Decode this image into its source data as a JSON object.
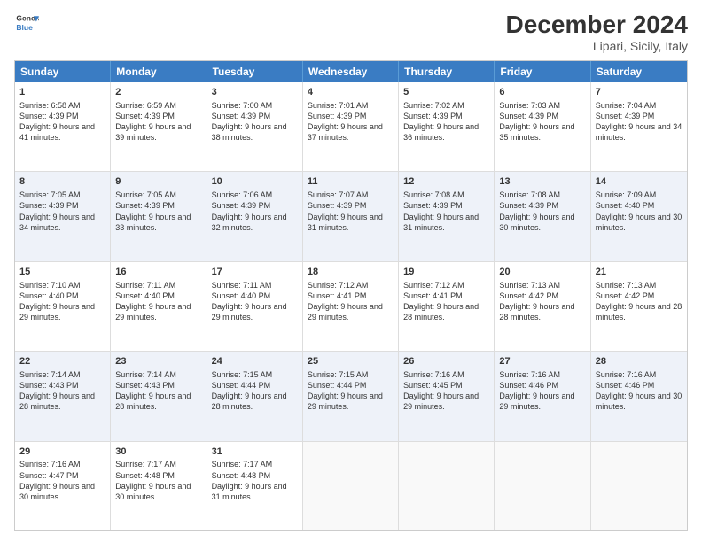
{
  "header": {
    "logo_line1": "General",
    "logo_line2": "Blue",
    "title": "December 2024",
    "subtitle": "Lipari, Sicily, Italy"
  },
  "calendar": {
    "days_of_week": [
      "Sunday",
      "Monday",
      "Tuesday",
      "Wednesday",
      "Thursday",
      "Friday",
      "Saturday"
    ],
    "rows": [
      [
        {
          "day": "1",
          "sunrise": "Sunrise: 6:58 AM",
          "sunset": "Sunset: 4:39 PM",
          "daylight": "Daylight: 9 hours and 41 minutes."
        },
        {
          "day": "2",
          "sunrise": "Sunrise: 6:59 AM",
          "sunset": "Sunset: 4:39 PM",
          "daylight": "Daylight: 9 hours and 39 minutes."
        },
        {
          "day": "3",
          "sunrise": "Sunrise: 7:00 AM",
          "sunset": "Sunset: 4:39 PM",
          "daylight": "Daylight: 9 hours and 38 minutes."
        },
        {
          "day": "4",
          "sunrise": "Sunrise: 7:01 AM",
          "sunset": "Sunset: 4:39 PM",
          "daylight": "Daylight: 9 hours and 37 minutes."
        },
        {
          "day": "5",
          "sunrise": "Sunrise: 7:02 AM",
          "sunset": "Sunset: 4:39 PM",
          "daylight": "Daylight: 9 hours and 36 minutes."
        },
        {
          "day": "6",
          "sunrise": "Sunrise: 7:03 AM",
          "sunset": "Sunset: 4:39 PM",
          "daylight": "Daylight: 9 hours and 35 minutes."
        },
        {
          "day": "7",
          "sunrise": "Sunrise: 7:04 AM",
          "sunset": "Sunset: 4:39 PM",
          "daylight": "Daylight: 9 hours and 34 minutes."
        }
      ],
      [
        {
          "day": "8",
          "sunrise": "Sunrise: 7:05 AM",
          "sunset": "Sunset: 4:39 PM",
          "daylight": "Daylight: 9 hours and 34 minutes."
        },
        {
          "day": "9",
          "sunrise": "Sunrise: 7:05 AM",
          "sunset": "Sunset: 4:39 PM",
          "daylight": "Daylight: 9 hours and 33 minutes."
        },
        {
          "day": "10",
          "sunrise": "Sunrise: 7:06 AM",
          "sunset": "Sunset: 4:39 PM",
          "daylight": "Daylight: 9 hours and 32 minutes."
        },
        {
          "day": "11",
          "sunrise": "Sunrise: 7:07 AM",
          "sunset": "Sunset: 4:39 PM",
          "daylight": "Daylight: 9 hours and 31 minutes."
        },
        {
          "day": "12",
          "sunrise": "Sunrise: 7:08 AM",
          "sunset": "Sunset: 4:39 PM",
          "daylight": "Daylight: 9 hours and 31 minutes."
        },
        {
          "day": "13",
          "sunrise": "Sunrise: 7:08 AM",
          "sunset": "Sunset: 4:39 PM",
          "daylight": "Daylight: 9 hours and 30 minutes."
        },
        {
          "day": "14",
          "sunrise": "Sunrise: 7:09 AM",
          "sunset": "Sunset: 4:40 PM",
          "daylight": "Daylight: 9 hours and 30 minutes."
        }
      ],
      [
        {
          "day": "15",
          "sunrise": "Sunrise: 7:10 AM",
          "sunset": "Sunset: 4:40 PM",
          "daylight": "Daylight: 9 hours and 29 minutes."
        },
        {
          "day": "16",
          "sunrise": "Sunrise: 7:11 AM",
          "sunset": "Sunset: 4:40 PM",
          "daylight": "Daylight: 9 hours and 29 minutes."
        },
        {
          "day": "17",
          "sunrise": "Sunrise: 7:11 AM",
          "sunset": "Sunset: 4:40 PM",
          "daylight": "Daylight: 9 hours and 29 minutes."
        },
        {
          "day": "18",
          "sunrise": "Sunrise: 7:12 AM",
          "sunset": "Sunset: 4:41 PM",
          "daylight": "Daylight: 9 hours and 29 minutes."
        },
        {
          "day": "19",
          "sunrise": "Sunrise: 7:12 AM",
          "sunset": "Sunset: 4:41 PM",
          "daylight": "Daylight: 9 hours and 28 minutes."
        },
        {
          "day": "20",
          "sunrise": "Sunrise: 7:13 AM",
          "sunset": "Sunset: 4:42 PM",
          "daylight": "Daylight: 9 hours and 28 minutes."
        },
        {
          "day": "21",
          "sunrise": "Sunrise: 7:13 AM",
          "sunset": "Sunset: 4:42 PM",
          "daylight": "Daylight: 9 hours and 28 minutes."
        }
      ],
      [
        {
          "day": "22",
          "sunrise": "Sunrise: 7:14 AM",
          "sunset": "Sunset: 4:43 PM",
          "daylight": "Daylight: 9 hours and 28 minutes."
        },
        {
          "day": "23",
          "sunrise": "Sunrise: 7:14 AM",
          "sunset": "Sunset: 4:43 PM",
          "daylight": "Daylight: 9 hours and 28 minutes."
        },
        {
          "day": "24",
          "sunrise": "Sunrise: 7:15 AM",
          "sunset": "Sunset: 4:44 PM",
          "daylight": "Daylight: 9 hours and 28 minutes."
        },
        {
          "day": "25",
          "sunrise": "Sunrise: 7:15 AM",
          "sunset": "Sunset: 4:44 PM",
          "daylight": "Daylight: 9 hours and 29 minutes."
        },
        {
          "day": "26",
          "sunrise": "Sunrise: 7:16 AM",
          "sunset": "Sunset: 4:45 PM",
          "daylight": "Daylight: 9 hours and 29 minutes."
        },
        {
          "day": "27",
          "sunrise": "Sunrise: 7:16 AM",
          "sunset": "Sunset: 4:46 PM",
          "daylight": "Daylight: 9 hours and 29 minutes."
        },
        {
          "day": "28",
          "sunrise": "Sunrise: 7:16 AM",
          "sunset": "Sunset: 4:46 PM",
          "daylight": "Daylight: 9 hours and 30 minutes."
        }
      ],
      [
        {
          "day": "29",
          "sunrise": "Sunrise: 7:16 AM",
          "sunset": "Sunset: 4:47 PM",
          "daylight": "Daylight: 9 hours and 30 minutes."
        },
        {
          "day": "30",
          "sunrise": "Sunrise: 7:17 AM",
          "sunset": "Sunset: 4:48 PM",
          "daylight": "Daylight: 9 hours and 30 minutes."
        },
        {
          "day": "31",
          "sunrise": "Sunrise: 7:17 AM",
          "sunset": "Sunset: 4:48 PM",
          "daylight": "Daylight: 9 hours and 31 minutes."
        },
        null,
        null,
        null,
        null
      ]
    ]
  }
}
